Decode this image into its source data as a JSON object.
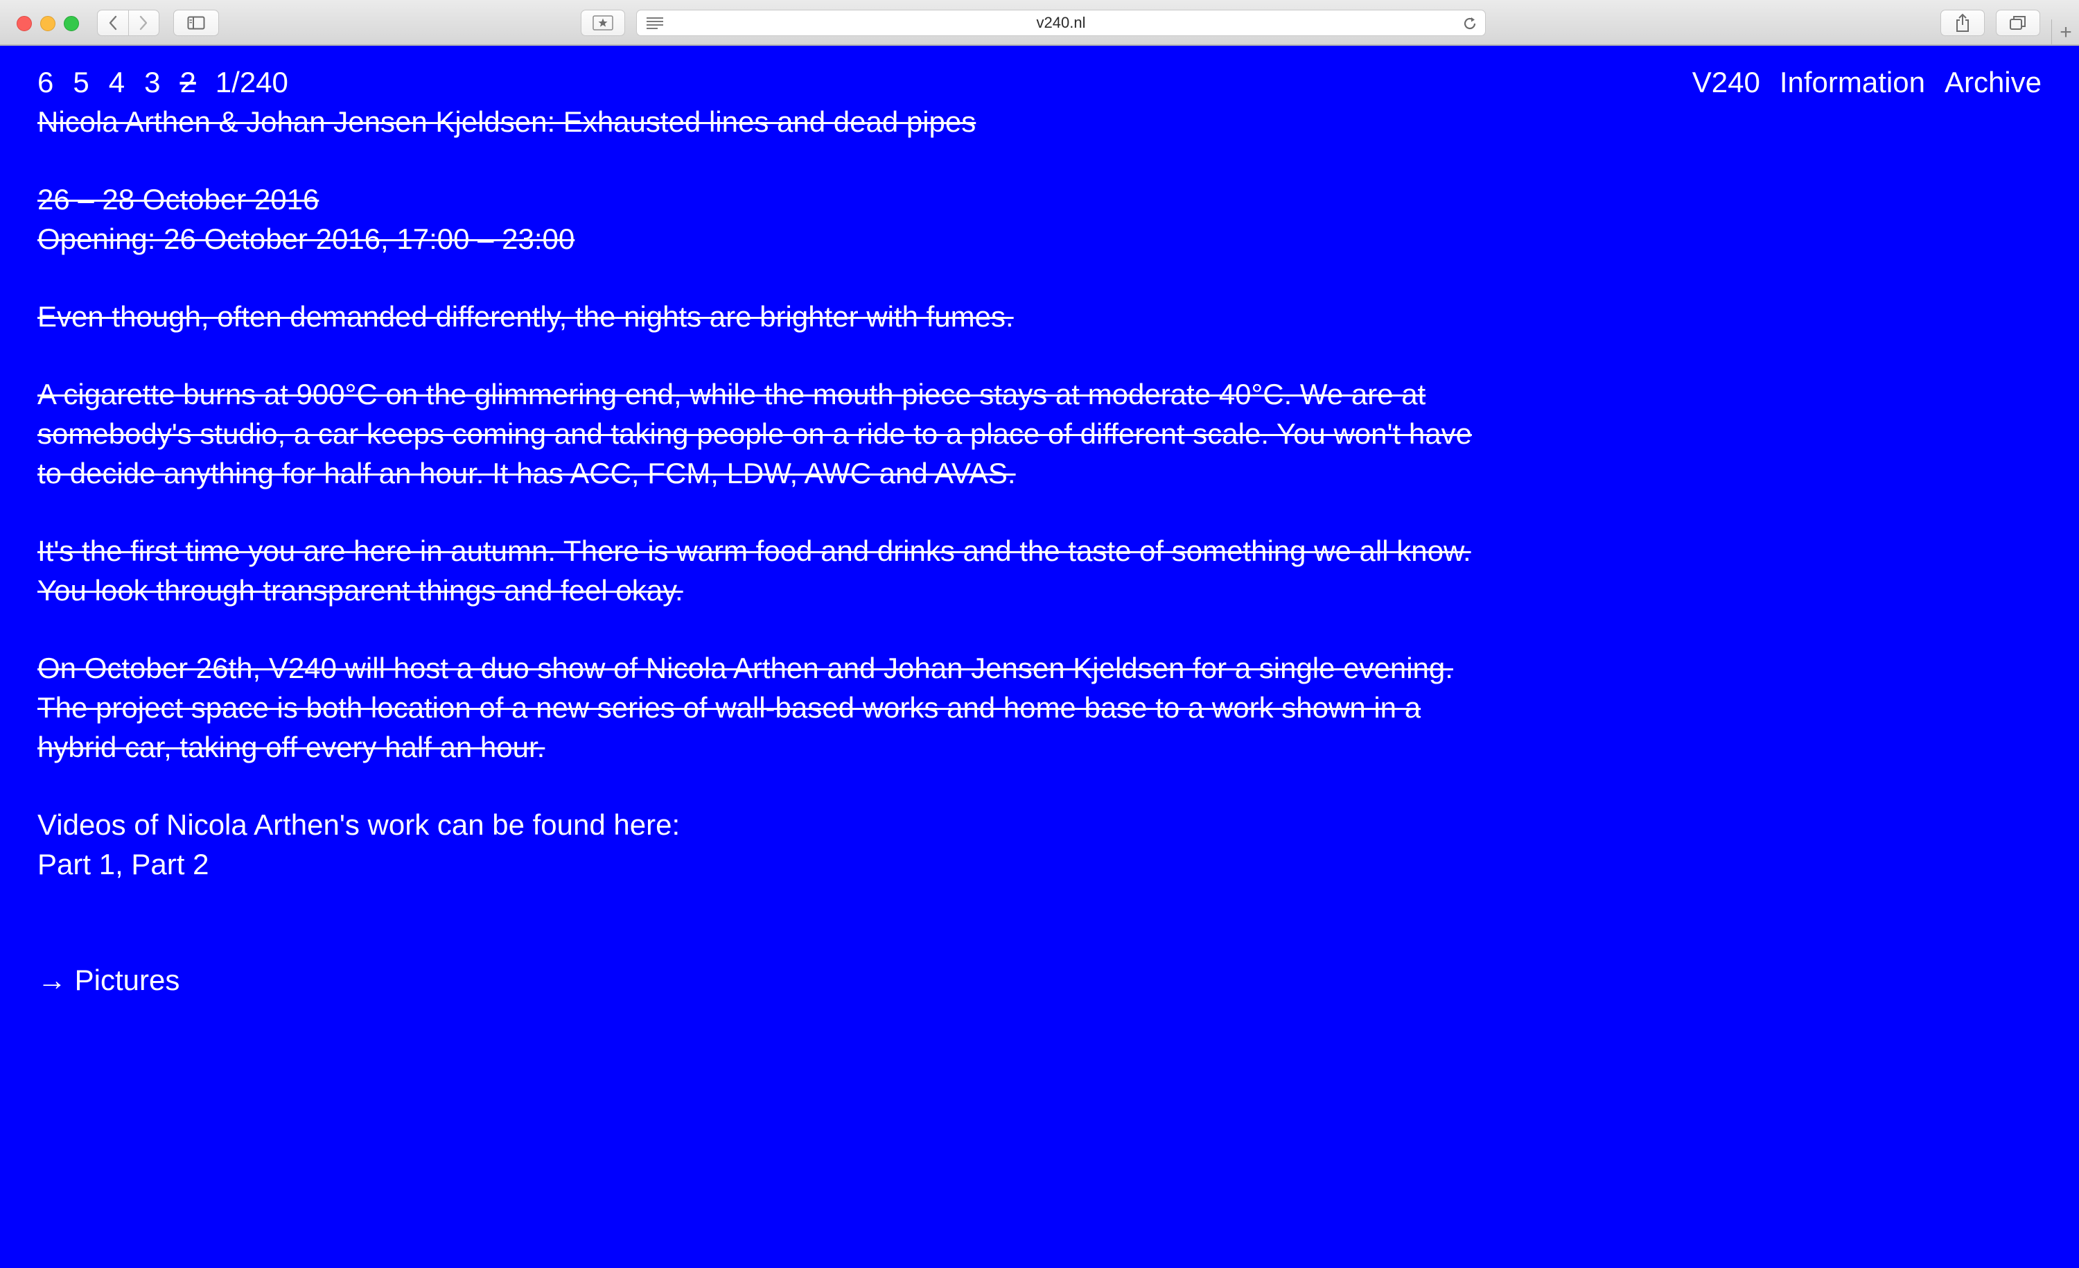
{
  "browser": {
    "url": "v240.nl",
    "new_tab_label": "+"
  },
  "nav": {
    "pages": [
      {
        "label": "6",
        "struck": false
      },
      {
        "label": "5",
        "struck": false
      },
      {
        "label": "4",
        "struck": false
      },
      {
        "label": "3",
        "struck": false
      },
      {
        "label": "2",
        "struck": true
      },
      {
        "label": "1/240",
        "struck": false
      }
    ],
    "right": {
      "home": "V240",
      "information": "Information",
      "archive": "Archive"
    }
  },
  "article": {
    "title": "Nicola Arthen & Johan Jensen Kjeldsen: Exhausted lines and dead pipes",
    "dates": "26 – 28 October 2016",
    "opening": "Opening: 26 October 2016, 17:00 – 23:00",
    "para1": "Even though, often demanded differently, the nights are brighter with fumes.",
    "para2": "A cigarette burns at 900°C on the glimmering end, while the mouth piece stays at moderate 40°C. We are at somebody's studio, a car keeps coming and taking people on a ride to a place of different scale. You won't have to decide anything for half an hour. It has ACC, FCM, LDW, AWC and AVAS.",
    "para3": "It's the first time you are here in autumn. There is warm food and drinks and the taste of something we all know. You look through transparent things and feel okay.",
    "para4": "On October 26th, V240 will host a duo show of Nicola Arthen and Johan Jensen Kjeldsen for a single evening. The project space is both location of a new series of wall-based works and home base to a work shown in a hybrid car, taking off every half an hour.",
    "videos_intro": "Videos of Nicola Arthen's work can be found here:",
    "video_part1": "Part 1",
    "video_sep": ", ",
    "video_part2": "Part 2",
    "pictures_link": "→ Pictures"
  },
  "colors": {
    "page_background": "#0000ff",
    "text": "#ffffff"
  },
  "icons": {
    "back": "chevron-left-icon",
    "forward": "chevron-right-icon",
    "sidebar": "sidebar-icon",
    "bookmark": "star-icon",
    "reader": "reader-icon",
    "reload": "reload-icon",
    "share": "share-icon",
    "tabs": "tabs-icon"
  }
}
